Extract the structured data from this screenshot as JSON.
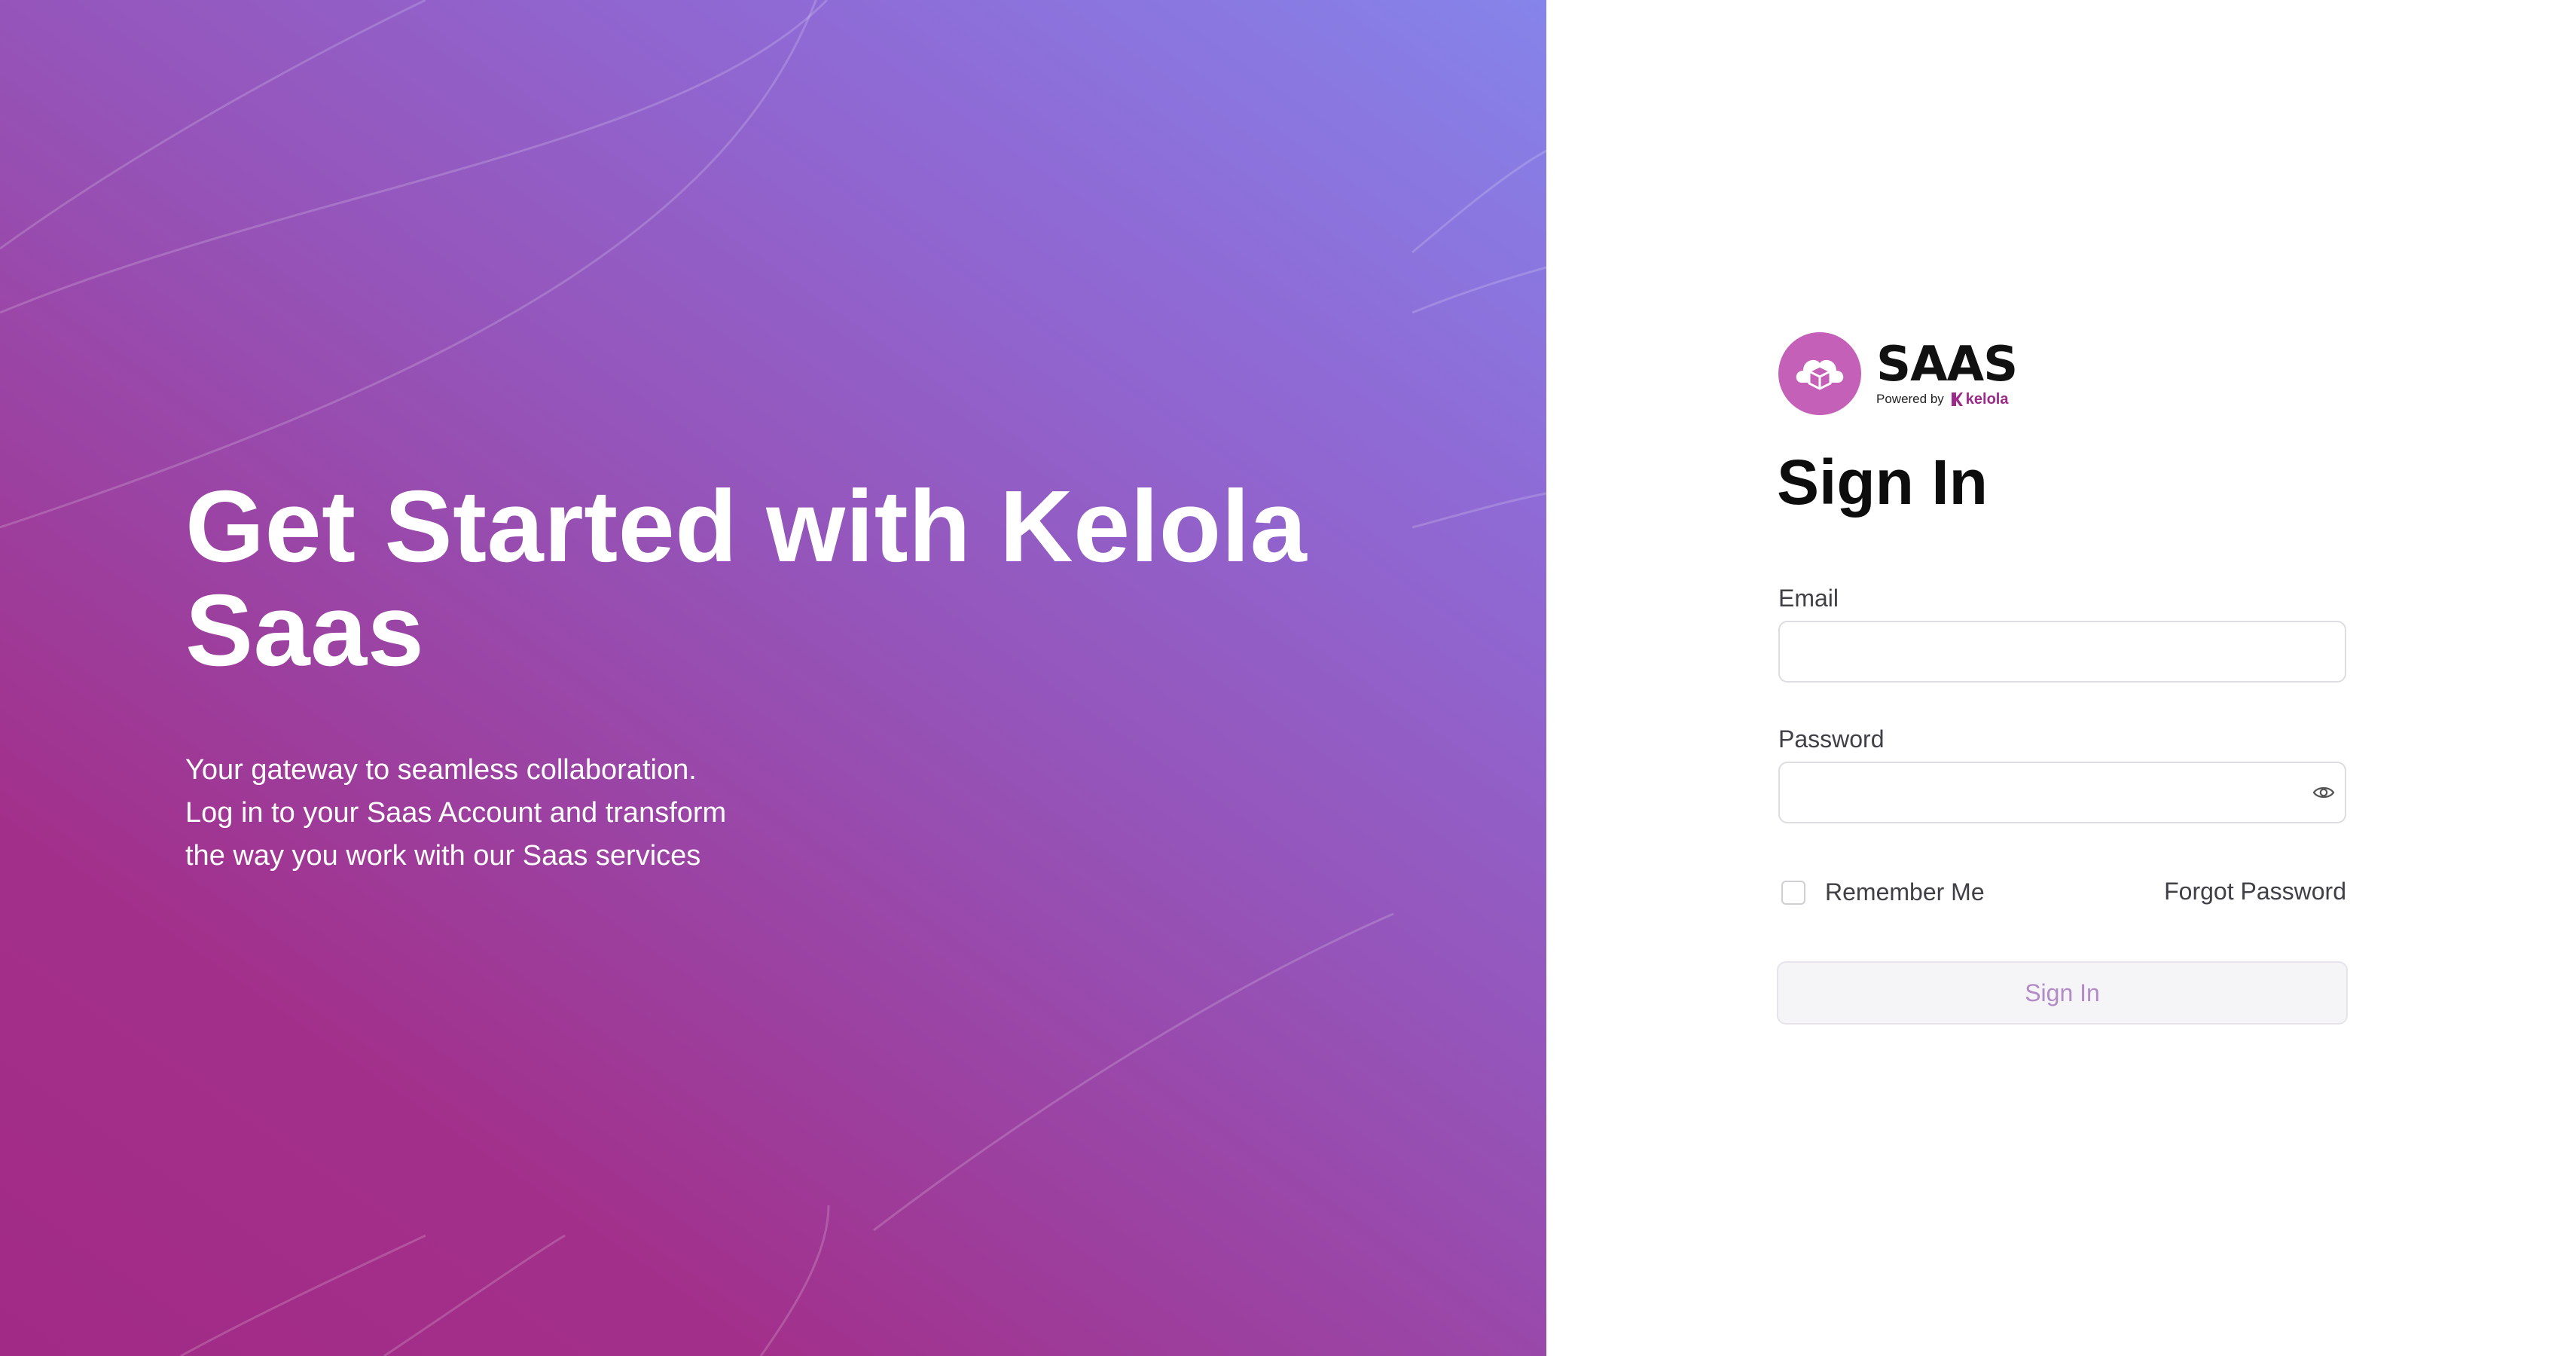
{
  "hero": {
    "title_line1": "Get Started with Kelola",
    "title_line2": "Saas",
    "subtitle_lines": [
      "Your gateway to seamless collaboration.",
      "Log in to your Saas Account and transform",
      "the way you work with our Saas services"
    ]
  },
  "brand": {
    "name": "SAAS",
    "powered_by": "Powered by",
    "partner": "kelola",
    "logo_icon": "box-cloud-icon"
  },
  "form": {
    "title": "Sign In",
    "email": {
      "label": "Email",
      "value": "",
      "placeholder": ""
    },
    "password": {
      "label": "Password",
      "value": "",
      "placeholder": "",
      "toggle_icon": "eye-icon"
    },
    "remember_label": "Remember Me",
    "remember_checked": false,
    "forgot_label": "Forgot Password",
    "submit_label": "Sign In"
  },
  "colors": {
    "gradient_start": "#a12a86",
    "gradient_end": "#8584ea",
    "brand_accent": "#c560b8",
    "button_text": "#b28ac6"
  }
}
